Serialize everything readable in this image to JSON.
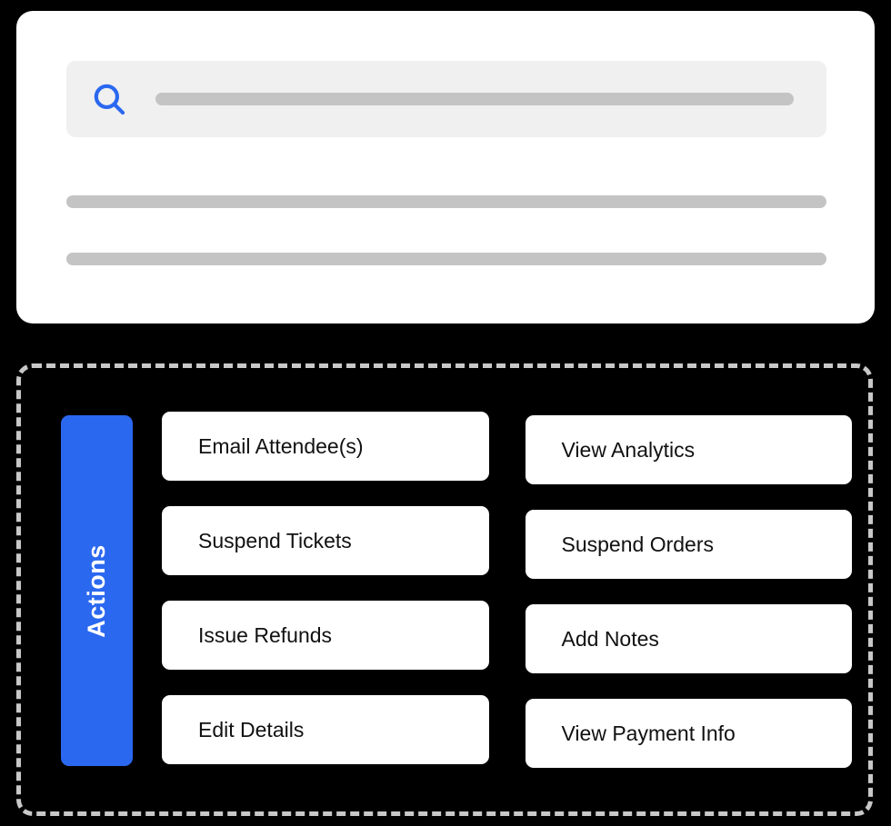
{
  "search_card": {
    "icon": "search-icon",
    "accent_color": "#2b68f0",
    "search_placeholder": "",
    "search_value": "",
    "placeholder_lines": [
      "",
      ""
    ]
  },
  "actions_panel": {
    "tab_label": "Actions",
    "tab_color": "#2b68f0",
    "border_style": "dashed",
    "border_color": "#c8c8c8",
    "columns": [
      {
        "buttons": [
          {
            "label": "Email Attendee(s)"
          },
          {
            "label": "Suspend Tickets"
          },
          {
            "label": "Issue Refunds"
          },
          {
            "label": "Edit Details"
          }
        ]
      },
      {
        "buttons": [
          {
            "label": "View Analytics"
          },
          {
            "label": "Suspend Orders"
          },
          {
            "label": "Add Notes"
          },
          {
            "label": "View Payment Info"
          }
        ]
      }
    ]
  }
}
